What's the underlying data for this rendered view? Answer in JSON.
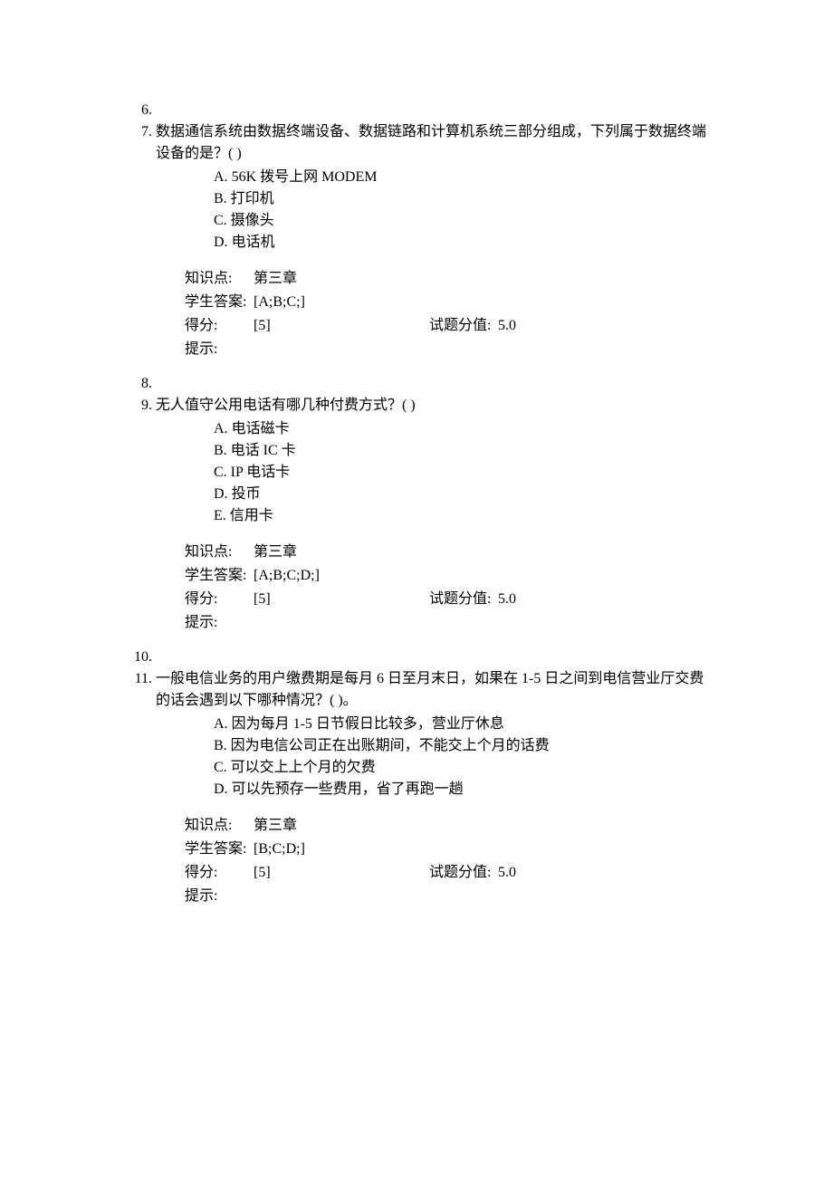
{
  "start_number": 6,
  "items": [
    {
      "type": "spacer"
    },
    {
      "type": "question",
      "text": "数据通信系统由数据终端设备、数据链路和计算机系统三部分组成，下列属于数据终端设备的是？( )",
      "options": [
        {
          "letter": "A.",
          "text": "56K 拨号上网 MODEM"
        },
        {
          "letter": "B.",
          "text": "打印机"
        },
        {
          "letter": "C.",
          "text": "摄像头"
        },
        {
          "letter": "D.",
          "text": "电话机"
        }
      ],
      "meta": {
        "kp_label": "知识点:",
        "kp_value": "第三章",
        "ans_label": "学生答案:",
        "ans_value": "[A;B;C;]",
        "score_label": "得分:",
        "score_value": "[5]",
        "max_label": "试题分值:",
        "max_value": "5.0",
        "hint_label": "提示:",
        "hint_value": ""
      }
    },
    {
      "type": "spacer"
    },
    {
      "type": "question",
      "text": "无人值守公用电话有哪几种付费方式？( )",
      "options": [
        {
          "letter": "A.",
          "text": "电话磁卡"
        },
        {
          "letter": "B.",
          "text": "电话 IC 卡"
        },
        {
          "letter": "C.",
          "text": "IP 电话卡"
        },
        {
          "letter": "D.",
          "text": "投币"
        },
        {
          "letter": "E.",
          "text": "信用卡"
        }
      ],
      "meta": {
        "kp_label": "知识点:",
        "kp_value": "第三章",
        "ans_label": "学生答案:",
        "ans_value": "[A;B;C;D;]",
        "score_label": "得分:",
        "score_value": "[5]",
        "max_label": "试题分值:",
        "max_value": "5.0",
        "hint_label": "提示:",
        "hint_value": ""
      }
    },
    {
      "type": "spacer"
    },
    {
      "type": "question",
      "text": "一般电信业务的用户缴费期是每月 6 日至月末日，如果在 1-5 日之间到电信营业厅交费的话会遇到以下哪种情况？( )。",
      "options": [
        {
          "letter": "A.",
          "text": "因为每月 1-5 日节假日比较多，营业厅休息"
        },
        {
          "letter": "B.",
          "text": "因为电信公司正在出账期间，不能交上个月的话费"
        },
        {
          "letter": "C.",
          "text": "可以交上上个月的欠费"
        },
        {
          "letter": "D.",
          "text": "可以先预存一些费用，省了再跑一趟"
        }
      ],
      "meta": {
        "kp_label": "知识点:",
        "kp_value": "第三章",
        "ans_label": "学生答案:",
        "ans_value": "[B;C;D;]",
        "score_label": "得分:",
        "score_value": "[5]",
        "max_label": "试题分值:",
        "max_value": "5.0",
        "hint_label": "提示:",
        "hint_value": ""
      }
    }
  ]
}
